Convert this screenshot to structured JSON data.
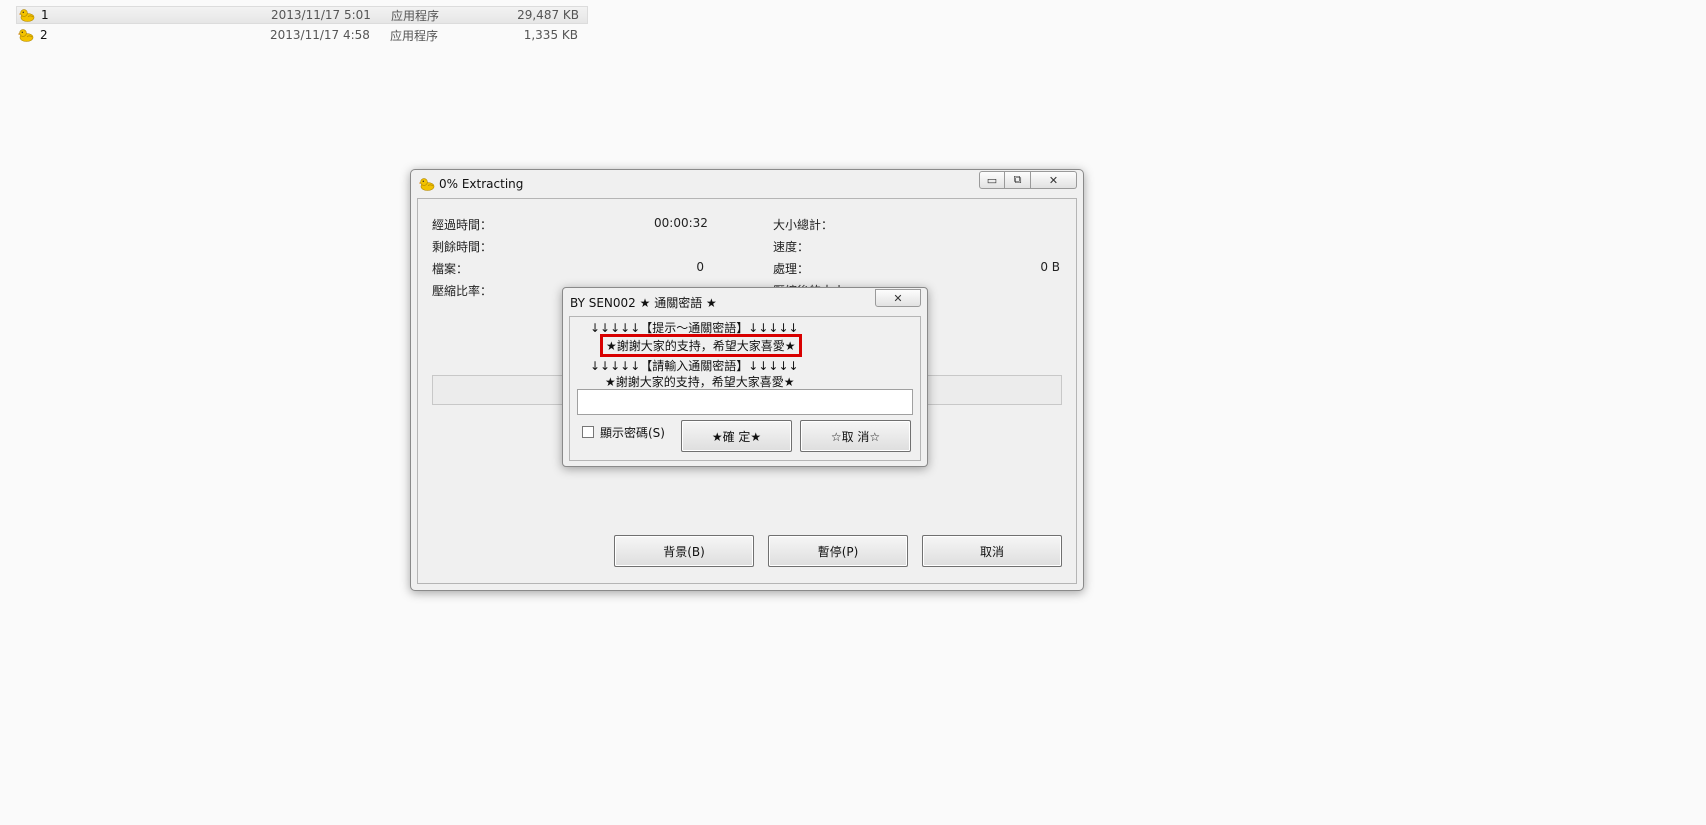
{
  "files": [
    {
      "name": "1",
      "date": "2013/11/17 5:01",
      "type": "应用程序",
      "size": "29,487 KB",
      "selected": true
    },
    {
      "name": "2",
      "date": "2013/11/17 4:58",
      "type": "应用程序",
      "size": "1,335 KB",
      "selected": false
    }
  ],
  "window": {
    "title": "0% Extracting",
    "stats": {
      "elapsed_label": "經過時間：",
      "elapsed_value": "00:00:32",
      "remaining_label": "剩餘時間：",
      "files_label": "檔案：",
      "files_value": "0",
      "ratio_label": "壓縮比率：",
      "total_size_label": "大小總計：",
      "speed_label": "速度：",
      "processed_label": "處理：",
      "processed_value": "0 B",
      "packed_size_label": "壓縮後的大小"
    },
    "buttons": {
      "background": "背景(B)",
      "pause": "暫停(P)",
      "cancel": "取消"
    }
  },
  "dialog": {
    "title": "BY SEN002 ★ 通關密語 ★",
    "hint_header": "↓↓↓↓↓【提示～通關密語】↓↓↓↓↓",
    "hint_text": "★謝謝大家的支持，希望大家喜愛★",
    "prompt_header": "↓↓↓↓↓【請輸入通關密語】↓↓↓↓↓",
    "prompt_text": "★謝謝大家的支持，希望大家喜愛★",
    "password_value": "",
    "show_password_label": "顯示密碼(S)",
    "ok_label": "★確 定★",
    "cancel_label": "☆取 消☆",
    "accent_color": "#d80000"
  }
}
